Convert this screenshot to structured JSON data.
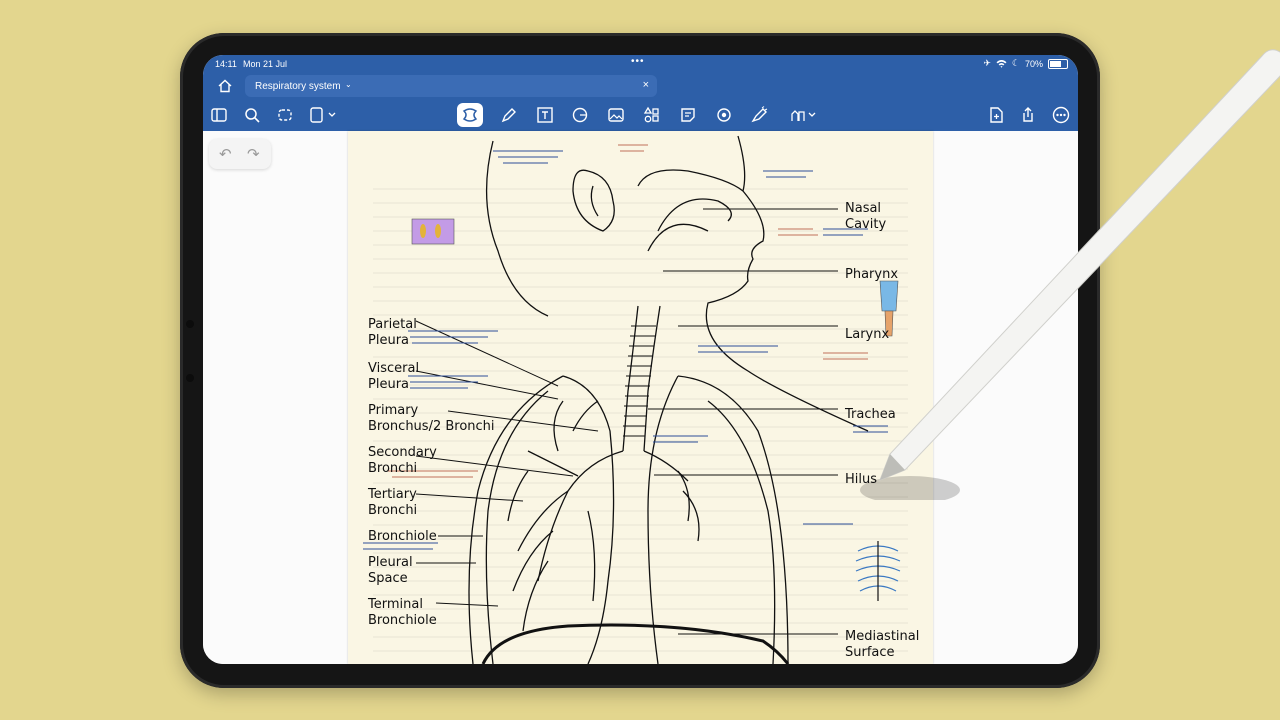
{
  "status": {
    "time": "14:11",
    "date": "Mon 21 Jul",
    "battery": "70%",
    "battery_level": 0.7
  },
  "tab": {
    "title": "Respiratory system"
  },
  "labels": {
    "nasal_cavity": "Nasal\nCavity",
    "pharynx": "Pharynx",
    "larynx": "Larynx",
    "trachea": "Trachea",
    "hilus": "Hilus",
    "mediastinal_surface": "Mediastinal\nSurface",
    "parietal_pleura": "Parietal\nPleura",
    "visceral_pleura": "Visceral\nPleura",
    "primary_bronchus": "Primary\nBronchus/2 Bronchi",
    "secondary_bronchi": "Secondary\nBronchi",
    "tertiary_bronchi": "Tertiary\nBronchi",
    "bronchiole": "Bronchiole",
    "pleural_space": "Pleural\nSpace",
    "terminal_bronchiole": "Terminal\nBronchiole"
  },
  "colors": {
    "chrome": "#2d5fa8",
    "background": "#e3d68e",
    "paper": "#faf6e4",
    "ink": "#111111"
  },
  "icons": [
    "home-icon",
    "sidebar-icon",
    "search-icon",
    "lasso-icon",
    "template-icon",
    "shapes-select-icon",
    "pen-icon",
    "text-box-icon",
    "shape-icon",
    "image-icon",
    "elements-icon",
    "sticky-note-icon",
    "laser-icon",
    "highlighter-icon",
    "toolset-icon",
    "add-page-icon",
    "share-icon",
    "more-icon"
  ]
}
